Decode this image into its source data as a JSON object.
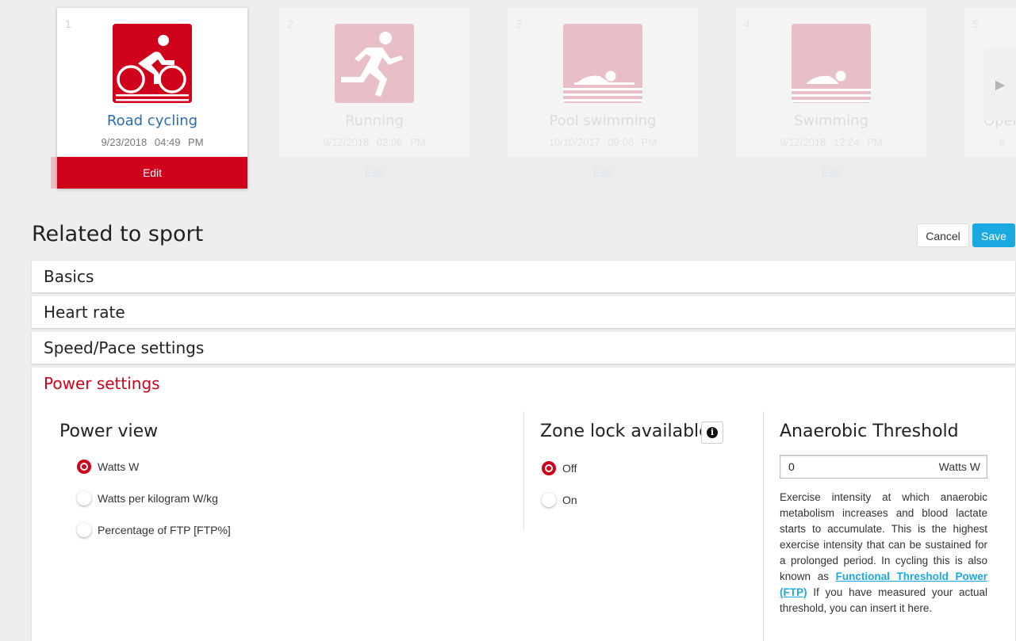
{
  "carousel": {
    "cards": [
      {
        "index": "1",
        "name": "Road cycling",
        "date": "9/23/2018",
        "time": "04:49 PM",
        "edit": "Edit",
        "icon": "road-cycling-icon",
        "active": true
      },
      {
        "index": "2",
        "name": "Running",
        "date": "9/12/2018",
        "time": "02:06 PM",
        "edit": "Edit",
        "icon": "running-icon",
        "active": false
      },
      {
        "index": "3",
        "name": "Pool swimming",
        "date": "10/10/2017",
        "time": "09:06 PM",
        "edit": "Edit",
        "icon": "pool-swimming-icon",
        "active": false
      },
      {
        "index": "4",
        "name": "Swimming",
        "date": "9/12/2018",
        "time": "12:24 PM",
        "edit": "Edit",
        "icon": "swimming-icon",
        "active": false
      },
      {
        "index": "5",
        "name": "Oper",
        "date": "6",
        "time": "",
        "edit": "",
        "icon": "",
        "active": false
      }
    ],
    "next_icon": "chevron-right-icon"
  },
  "header": {
    "title": "Related to sport",
    "cancel_label": "Cancel",
    "save_label": "Save"
  },
  "sections": {
    "basics": "Basics",
    "heart_rate": "Heart rate",
    "speed_pace": "Speed/Pace settings",
    "power": "Power settings"
  },
  "power_view": {
    "title": "Power view",
    "options": [
      "Watts W",
      "Watts per kilogram W/kg",
      "Percentage of FTP [FTP%]"
    ],
    "selected": 0
  },
  "zone_lock": {
    "title": "Zone lock available",
    "info_icon": "info-icon",
    "options": [
      "Off",
      "On"
    ],
    "selected": 0
  },
  "anaerobic": {
    "title": "Anaerobic Threshold",
    "value": "0",
    "unit": "Watts W",
    "desc_part1": "Exercise intensity at which anaerobic metabolism increases and blood lactate starts to accumulate. This is the highest exercise intensity that can be sustained for a prolonged period. In cycling this is also known as ",
    "link": "Functional Threshold Power (FTP)",
    "desc_part2": " If you have measured your actual threshold, you can insert it here."
  },
  "colors": {
    "brand_red": "#d0021b",
    "faded_red": "#e9bfc7",
    "save_blue": "#1ba9e1",
    "link_blue": "#2b6cb0"
  }
}
